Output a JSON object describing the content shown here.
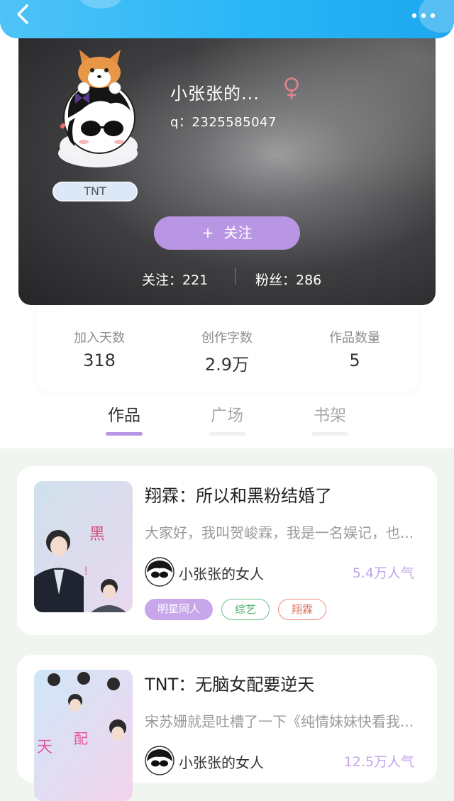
{
  "profile": {
    "username": "小张张的...",
    "qq": "q：2325585047",
    "tag": "TNT",
    "follow_button": "关注",
    "follow_plus": "+",
    "following": "关注：221",
    "fans": "粉丝：286"
  },
  "stats": [
    {
      "label": "加入天数",
      "value": "318"
    },
    {
      "label": "创作字数",
      "value": "2.9万"
    },
    {
      "label": "作品数量",
      "value": "5"
    }
  ],
  "tabs": [
    {
      "label": "作品",
      "active": true
    },
    {
      "label": "广场",
      "active": false
    },
    {
      "label": "书架",
      "active": false
    }
  ],
  "works": [
    {
      "title": "翔霖：所以和黑粉结婚了",
      "description": "大家好，我叫贺峻霖，我是一名娱记，也...",
      "author": "小张张的女人",
      "popularity": "5.4万人气",
      "tags": [
        "明星同人",
        "综艺",
        "翔霖"
      ]
    },
    {
      "title": "TNT：无脑女配要逆天",
      "description": "宋苏姗就是吐槽了一下《纯情妹妹快看我...",
      "author": "小张张的女人",
      "popularity": "12.5万人气",
      "tags": []
    }
  ],
  "colors": {
    "header": "#29b6f6",
    "accent": "#b996e3",
    "popularity": "#c2a4ec",
    "gender": "#e6727d"
  },
  "icons": {
    "back": "chevron-left-icon",
    "more": "more-dots-icon",
    "gender": "female-icon"
  }
}
